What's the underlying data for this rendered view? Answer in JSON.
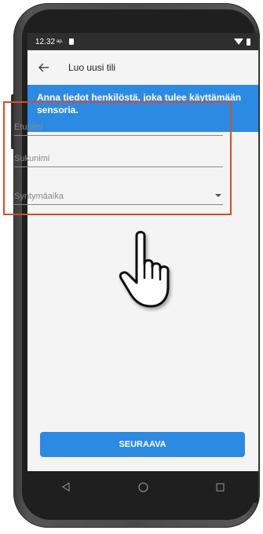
{
  "status": {
    "time": "12.32",
    "ampm": "ap."
  },
  "appbar": {
    "title": "Luo uusi tili"
  },
  "banner": {
    "text": "Anna tiedot henkilöstä, joka tulee käyttämään sensoria."
  },
  "form": {
    "first_name_placeholder": "Etunimi",
    "last_name_placeholder": "Sukunimi",
    "birthdate_placeholder": "Syntymäaika"
  },
  "actions": {
    "next_label": "SEURAAVA"
  },
  "colors": {
    "accent": "#2d8ae3",
    "highlight": "#e04a22"
  },
  "icons": [
    "back-arrow-icon",
    "chevron-down-icon",
    "pointer-hand-icon",
    "nav-back-icon",
    "nav-home-icon",
    "nav-recents-icon",
    "wifi-icon",
    "battery-icon",
    "notification-icon"
  ]
}
